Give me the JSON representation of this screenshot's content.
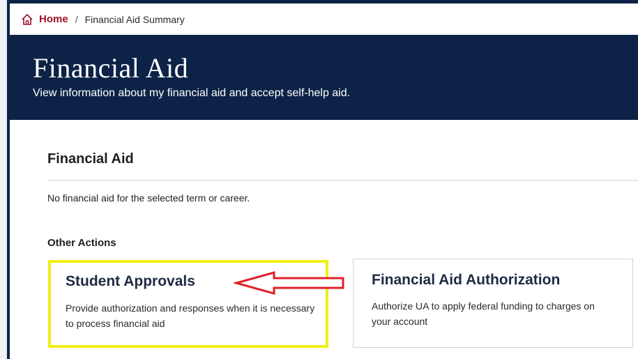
{
  "breadcrumb": {
    "home_label": "Home",
    "separator": "/",
    "current": "Financial Aid Summary",
    "home_icon": "home-icon"
  },
  "banner": {
    "title": "Financial Aid",
    "subtitle": "View information about my financial aid and accept self-help aid."
  },
  "section": {
    "title": "Financial Aid",
    "empty_message": "No financial aid for the selected term or career."
  },
  "other_actions": {
    "heading": "Other Actions",
    "cards": [
      {
        "title": "Student Approvals",
        "description": "Provide authorization and responses when it is necessary to process financial aid"
      },
      {
        "title": "Financial Aid Authorization",
        "description": "Authorize UA to apply federal funding to charges on your account"
      }
    ]
  },
  "colors": {
    "banner_bg": "#0c2347",
    "home_link": "#a01028",
    "highlight_border": "#f2ee16",
    "annotation_arrow": "#e0202a"
  }
}
